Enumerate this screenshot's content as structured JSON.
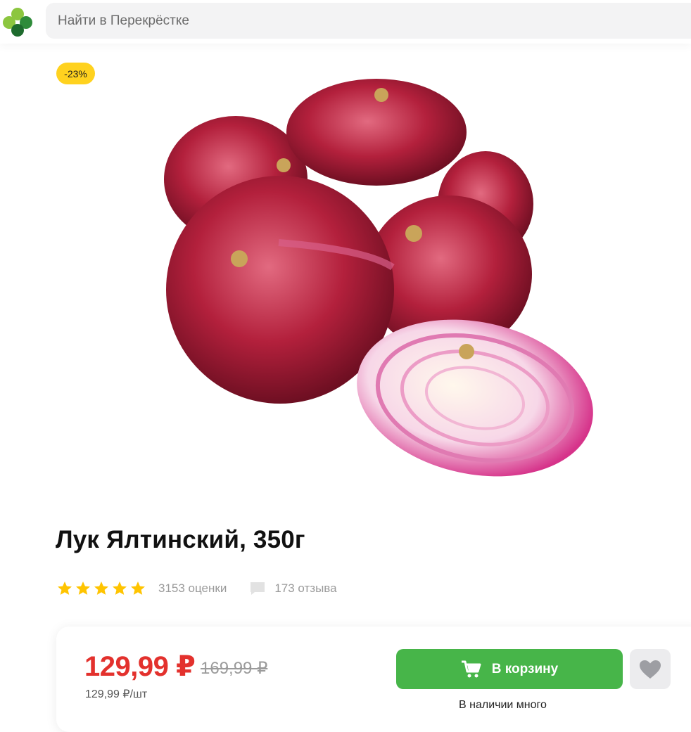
{
  "header": {
    "logo_icon": "clover-logo-icon",
    "search": {
      "placeholder": "Найти в Перекрёстке",
      "value": ""
    }
  },
  "product": {
    "discount_badge": "-23%",
    "image_icon": "red-onion-image",
    "title": "Лук Ялтинский, 350г",
    "rating": {
      "stars": 5,
      "ratings_count": "3153 оценки",
      "reviews_count": "173 отзыва"
    },
    "price": {
      "current": "129,99 ₽",
      "old": "169,99 ₽",
      "per_unit": "129,99 ₽/шт"
    },
    "actions": {
      "cart_label": "В корзину",
      "availability": "В наличии много"
    }
  },
  "colors": {
    "accent_green": "#47b549",
    "price_red": "#e3312d",
    "badge_yellow": "#ffd21f",
    "star_yellow": "#ffc400"
  }
}
